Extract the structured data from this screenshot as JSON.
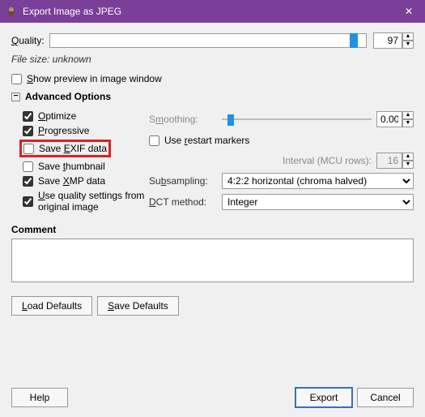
{
  "titlebar": {
    "title": "Export Image as JPEG",
    "close": "✕"
  },
  "quality": {
    "label": "Quality:",
    "value": "97",
    "thumb_pct": 95
  },
  "filesize": "File size: unknown",
  "show_preview": {
    "label": "Show preview in image window",
    "checked": false
  },
  "adv_header": "Advanced Options",
  "adv": {
    "optimize": {
      "label": "Optimize",
      "checked": true
    },
    "progressive": {
      "label": "Progressive",
      "checked": true
    },
    "save_exif": {
      "label": "Save EXIF data",
      "checked": false
    },
    "save_thumb": {
      "label": "Save thumbnail",
      "checked": false
    },
    "save_xmp": {
      "label": "Save XMP data",
      "checked": true
    },
    "use_quality": {
      "label": "Use quality settings from original image",
      "checked": true
    }
  },
  "smoothing": {
    "label": "Smoothing:",
    "value": "0.00",
    "thumb_pct": 4
  },
  "restart": {
    "label": "Use restart markers",
    "checked": false
  },
  "interval": {
    "label": "Interval (MCU rows):",
    "value": "16"
  },
  "subsampling": {
    "label": "Subsampling:",
    "value": "4:2:2 horizontal (chroma halved)"
  },
  "dct": {
    "label": "DCT method:",
    "value": "Integer"
  },
  "comment_label": "Comment",
  "comment_value": "",
  "buttons": {
    "load_defaults": "Load Defaults",
    "save_defaults": "Save Defaults",
    "help": "Help",
    "export": "Export",
    "cancel": "Cancel"
  }
}
